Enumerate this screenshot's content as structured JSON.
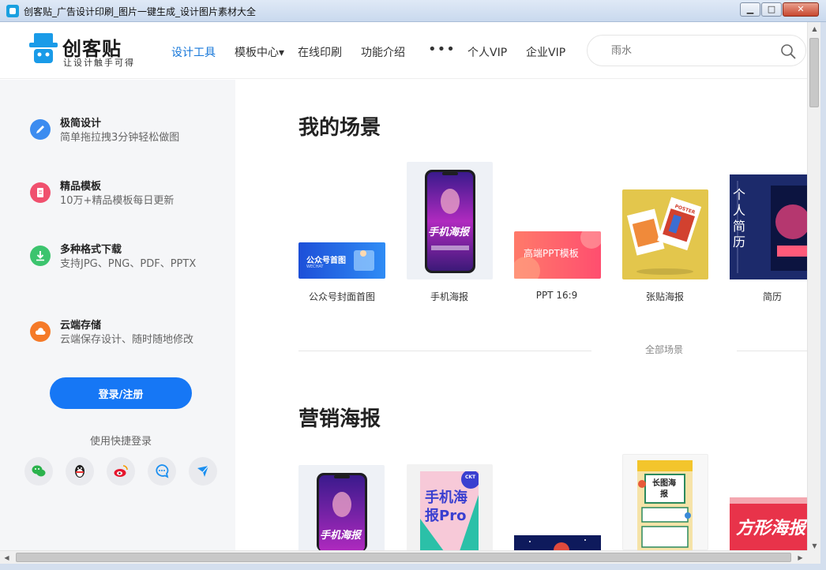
{
  "window": {
    "title": "创客贴_广告设计印刷_图片一键生成_设计图片素材大全",
    "min_glyph": "▁",
    "max_glyph": "□",
    "close_glyph": "✕"
  },
  "header": {
    "logo_name": "创客贴",
    "logo_slogan": "让设计触手可得",
    "nav": [
      {
        "label": "设计工具",
        "active": true
      },
      {
        "label": "模板中心▾"
      },
      {
        "label": "在线印刷"
      },
      {
        "label": "功能介绍"
      },
      {
        "label": "•••"
      },
      {
        "label": "个人VIP"
      },
      {
        "label": "企业VIP"
      }
    ],
    "search_placeholder": "雨水",
    "accent_color": "#1677f5"
  },
  "sidebar": {
    "features": [
      {
        "title": "极简设计",
        "desc": "简单拖拉拽3分钟轻松做图",
        "icon": "pencil-icon",
        "color": "#3c8cf0"
      },
      {
        "title": "精品模板",
        "desc": "10万+精品模板每日更新",
        "icon": "document-icon",
        "color": "#f0506e"
      },
      {
        "title": "多种格式下载",
        "desc": "支持JPG、PNG、PDF、PPTX",
        "icon": "download-icon",
        "color": "#3cc46e"
      },
      {
        "title": "云端存储",
        "desc": "云端保存设计、随时随地修改",
        "icon": "cloud-icon",
        "color": "#f57a28"
      }
    ],
    "login_label": "登录/注册",
    "quick_login_label": "使用快捷登录",
    "social": [
      "wechat-icon",
      "qq-icon",
      "weibo-icon",
      "dingtalk-chat-icon",
      "lark-icon"
    ]
  },
  "main": {
    "section1_title": "我的场景",
    "scenes": [
      {
        "label": "公众号封面首图",
        "thumb_text": "公众号首图",
        "thumb_sub": "WECHAT"
      },
      {
        "label": "手机海报",
        "thumb_text": "手机海报"
      },
      {
        "label": "PPT 16:9",
        "thumb_text": "高端PPT模板"
      },
      {
        "label": "张贴海报",
        "thumb_text": "POSTER"
      },
      {
        "label": "简历",
        "thumb_text": "个人简历"
      }
    ],
    "all_scenes_label": "全部场景",
    "section2_title": "营销海报",
    "posters": [
      {
        "thumb_text": "手机海报"
      },
      {
        "thumb_text": "手机海报Pro",
        "badge": "CKT"
      },
      {
        "thumb_text": ""
      },
      {
        "thumb_text": "长图海报"
      },
      {
        "thumb_text": "方形海报"
      }
    ]
  }
}
